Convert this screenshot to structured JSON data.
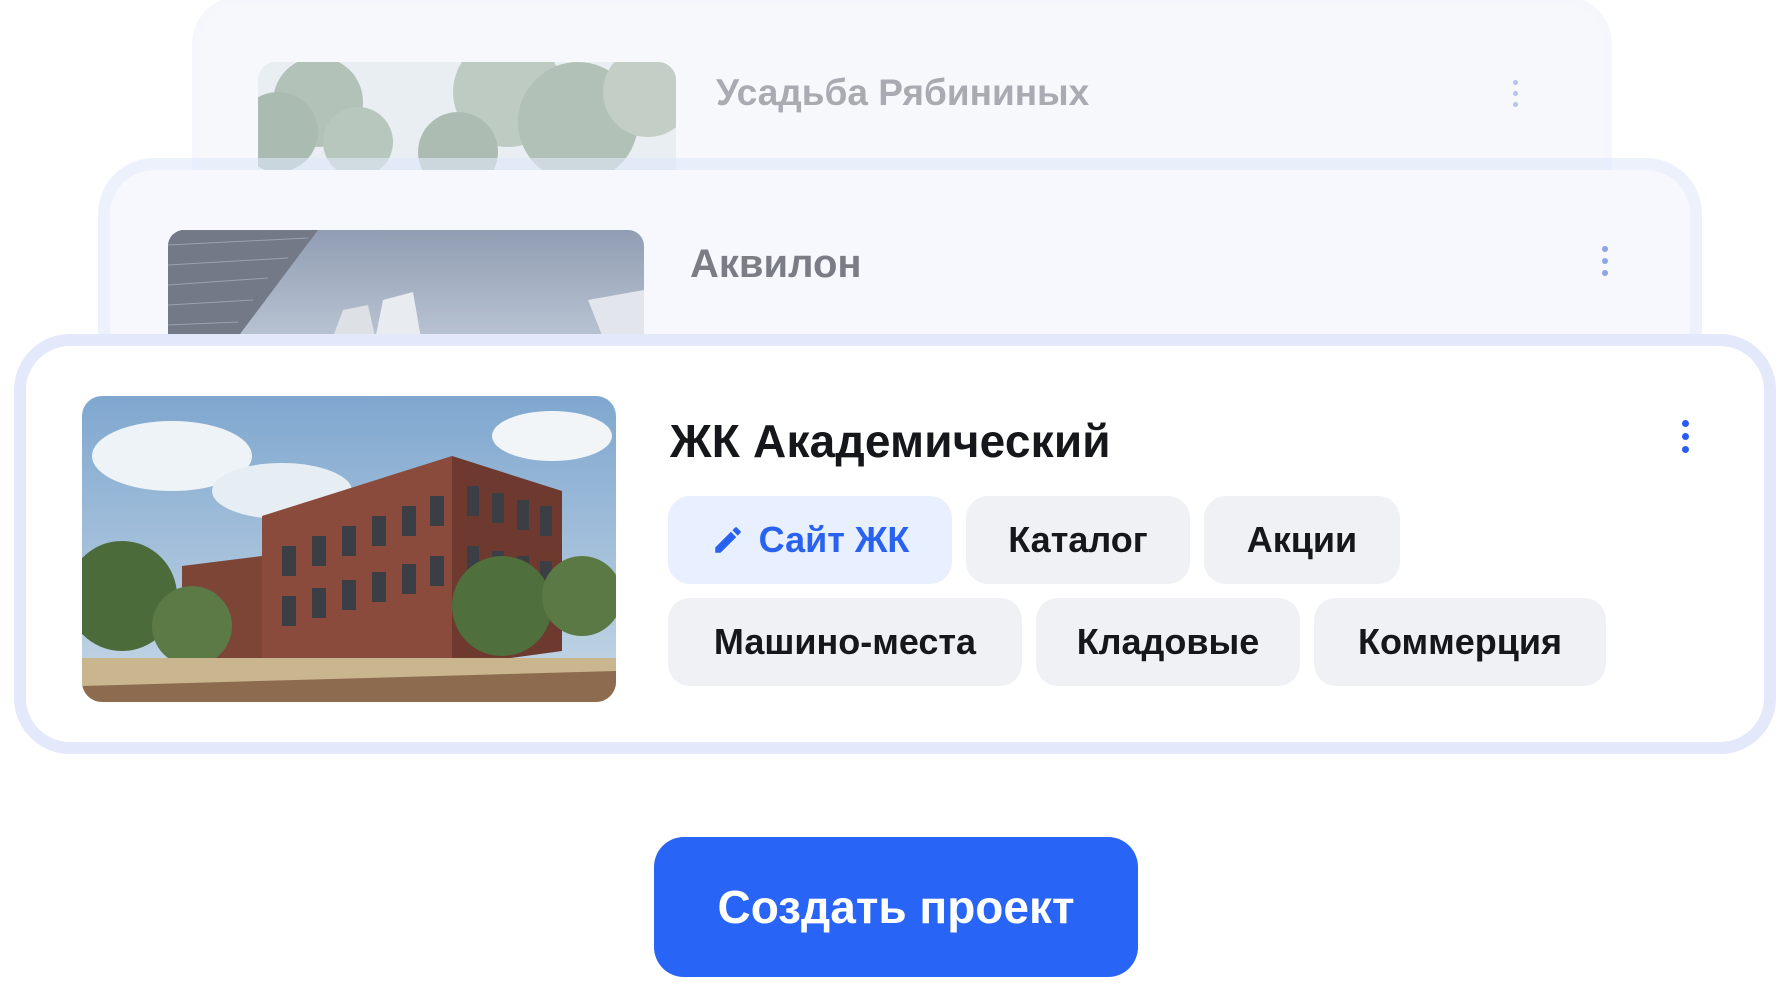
{
  "projects": [
    {
      "title": "Усадьба Рябининых",
      "image_icon": "trees-photo"
    },
    {
      "title": "Аквилон",
      "image_icon": "skyscrapers-photo"
    },
    {
      "title": "ЖК Академический",
      "image_icon": "brick-building-photo",
      "chips": [
        {
          "label": "Сайт ЖК",
          "active": true,
          "icon": "pencil-icon"
        },
        {
          "label": "Каталог",
          "active": false
        },
        {
          "label": "Акции",
          "active": false
        },
        {
          "label": "Машино-места",
          "active": false
        },
        {
          "label": "Кладовые",
          "active": false
        },
        {
          "label": "Коммерция",
          "active": false
        }
      ]
    }
  ],
  "create_button": {
    "label": "Создать проект"
  },
  "colors": {
    "accent": "#2864f6",
    "chip_bg": "#eff1f5",
    "chip_active_bg": "#e8efff",
    "chip_active_text": "#2a62f0",
    "card_border": "#e3e9fa"
  }
}
